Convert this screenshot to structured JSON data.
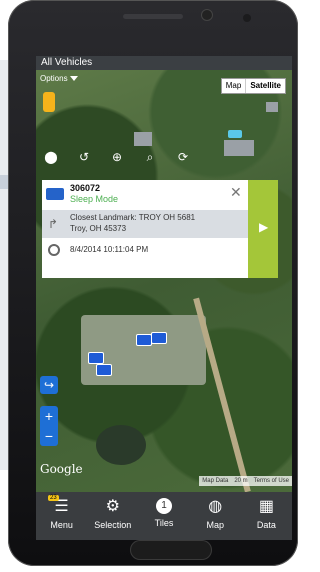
{
  "window": {
    "title": "All Vehicles"
  },
  "map": {
    "options_label": "Options",
    "map_type": {
      "map": "Map",
      "satellite": "Satellite",
      "selected": "Satellite"
    },
    "attribution": {
      "map_data": "Map Data",
      "scale": "20 m",
      "terms": "Terms of Use"
    },
    "google_logo": "Google"
  },
  "popup": {
    "vehicle_id": "306072",
    "status": "Sleep Mode",
    "landmark_line1": "Closest Landmark: TROY OH 5681",
    "landmark_line2": "Troy, OH 45373",
    "datetime": "8/4/2014 10:11:04 PM"
  },
  "tabs": [
    {
      "label": "Menu",
      "icon": "menu-icon",
      "badge": "23"
    },
    {
      "label": "Selection",
      "icon": "gear-icon"
    },
    {
      "label": "Tiles",
      "icon": "tiles-icon",
      "count": "1"
    },
    {
      "label": "Map",
      "icon": "globe-icon"
    },
    {
      "label": "Data",
      "icon": "data-icon"
    }
  ],
  "colors": {
    "accent_green": "#a4c639",
    "status_green": "#4caf50",
    "tabbar": "#3a3d40",
    "blue": "#1e6fd6"
  }
}
